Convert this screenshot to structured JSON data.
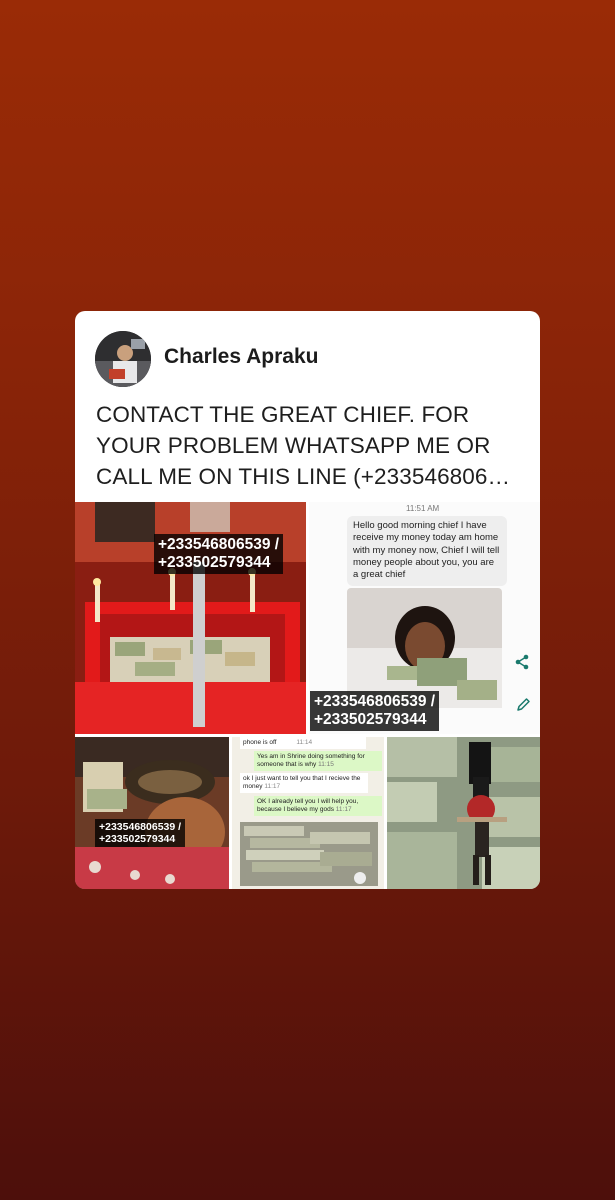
{
  "post": {
    "author": "Charles Apraku",
    "text": "CONTACT THE GREAT CHIEF. FOR YOUR PROBLEM WHATSAPP ME OR CALL ME ON THIS LINE (+233546806…"
  },
  "images": {
    "shrine": {
      "phone_1": "+233546806539 /",
      "phone_2": "+233502579344"
    },
    "chat": {
      "time": "11:51 AM",
      "message": "Hello good morning chief I have receive my money today am home with my money now, Chief I will tell money people about you, you are a great chief",
      "phone_1": "+233546806539 /",
      "phone_2": "+233502579344"
    },
    "snake": {
      "phone_1": "+233546806539 /",
      "phone_2": "+233502579344"
    },
    "chat2": {
      "line1": "phone is off",
      "line1_time": "11:14",
      "line2": "Yes am in Shrine doing something for someone that is why",
      "line2_time": "11:15",
      "line3": "ok I just want to tell you that I recieve the money",
      "line3_time": "11:17",
      "line4": "OK I already tell you I will help you, because I believe my gods",
      "line4_time": "11:17"
    }
  },
  "icons": {
    "share": "share-icon",
    "edit": "pencil-icon"
  },
  "colors": {
    "bg_top": "#9a2b06",
    "bg_bottom": "#4d0f0b",
    "card": "#ffffff",
    "share": "#1a7a6d"
  }
}
